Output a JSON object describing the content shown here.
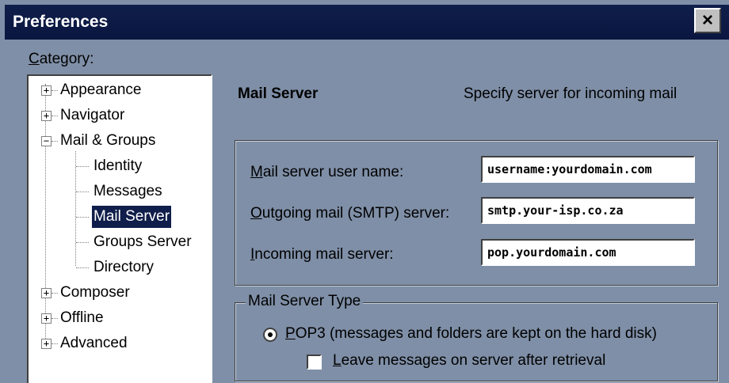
{
  "window": {
    "title": "Preferences",
    "close_label": "×"
  },
  "category": {
    "label_accel": "C",
    "label_rest": "ategory:"
  },
  "tree": {
    "items": [
      {
        "label": "Appearance",
        "expander": "+"
      },
      {
        "label": "Navigator",
        "expander": "+"
      },
      {
        "label": "Mail & Groups",
        "expander": "−"
      },
      {
        "label": "Identity"
      },
      {
        "label": "Messages"
      },
      {
        "label": "Mail Server",
        "selected": true
      },
      {
        "label": "Groups Server"
      },
      {
        "label": "Directory"
      },
      {
        "label": "Composer",
        "expander": "+"
      },
      {
        "label": "Offline",
        "expander": "+"
      },
      {
        "label": "Advanced",
        "expander": "+"
      }
    ]
  },
  "panel": {
    "title": "Mail Server",
    "description": "Specify server for incoming mail"
  },
  "fields": {
    "username": {
      "label_accel": "M",
      "label_rest": "ail server user name:",
      "value": "username:yourdomain.com"
    },
    "smtp": {
      "label_accel": "O",
      "label_rest": "utgoing mail (SMTP) server:",
      "value": "smtp.your-isp.co.za"
    },
    "incoming": {
      "label_accel": "I",
      "label_rest": "ncoming mail server:",
      "value": "pop.yourdomain.com"
    }
  },
  "server_type": {
    "legend": "Mail Server Type",
    "pop3": {
      "accel": "P",
      "rest": "OP3 (messages and folders are kept on the hard disk)",
      "checked": true
    },
    "leave_messages": {
      "accel": "L",
      "rest": "eave messages on server after retrieval",
      "checked": false
    }
  },
  "colors": {
    "background": "#7f8fa7",
    "titlebar": "#0f1e4a",
    "selection": "#0f1e4a"
  }
}
